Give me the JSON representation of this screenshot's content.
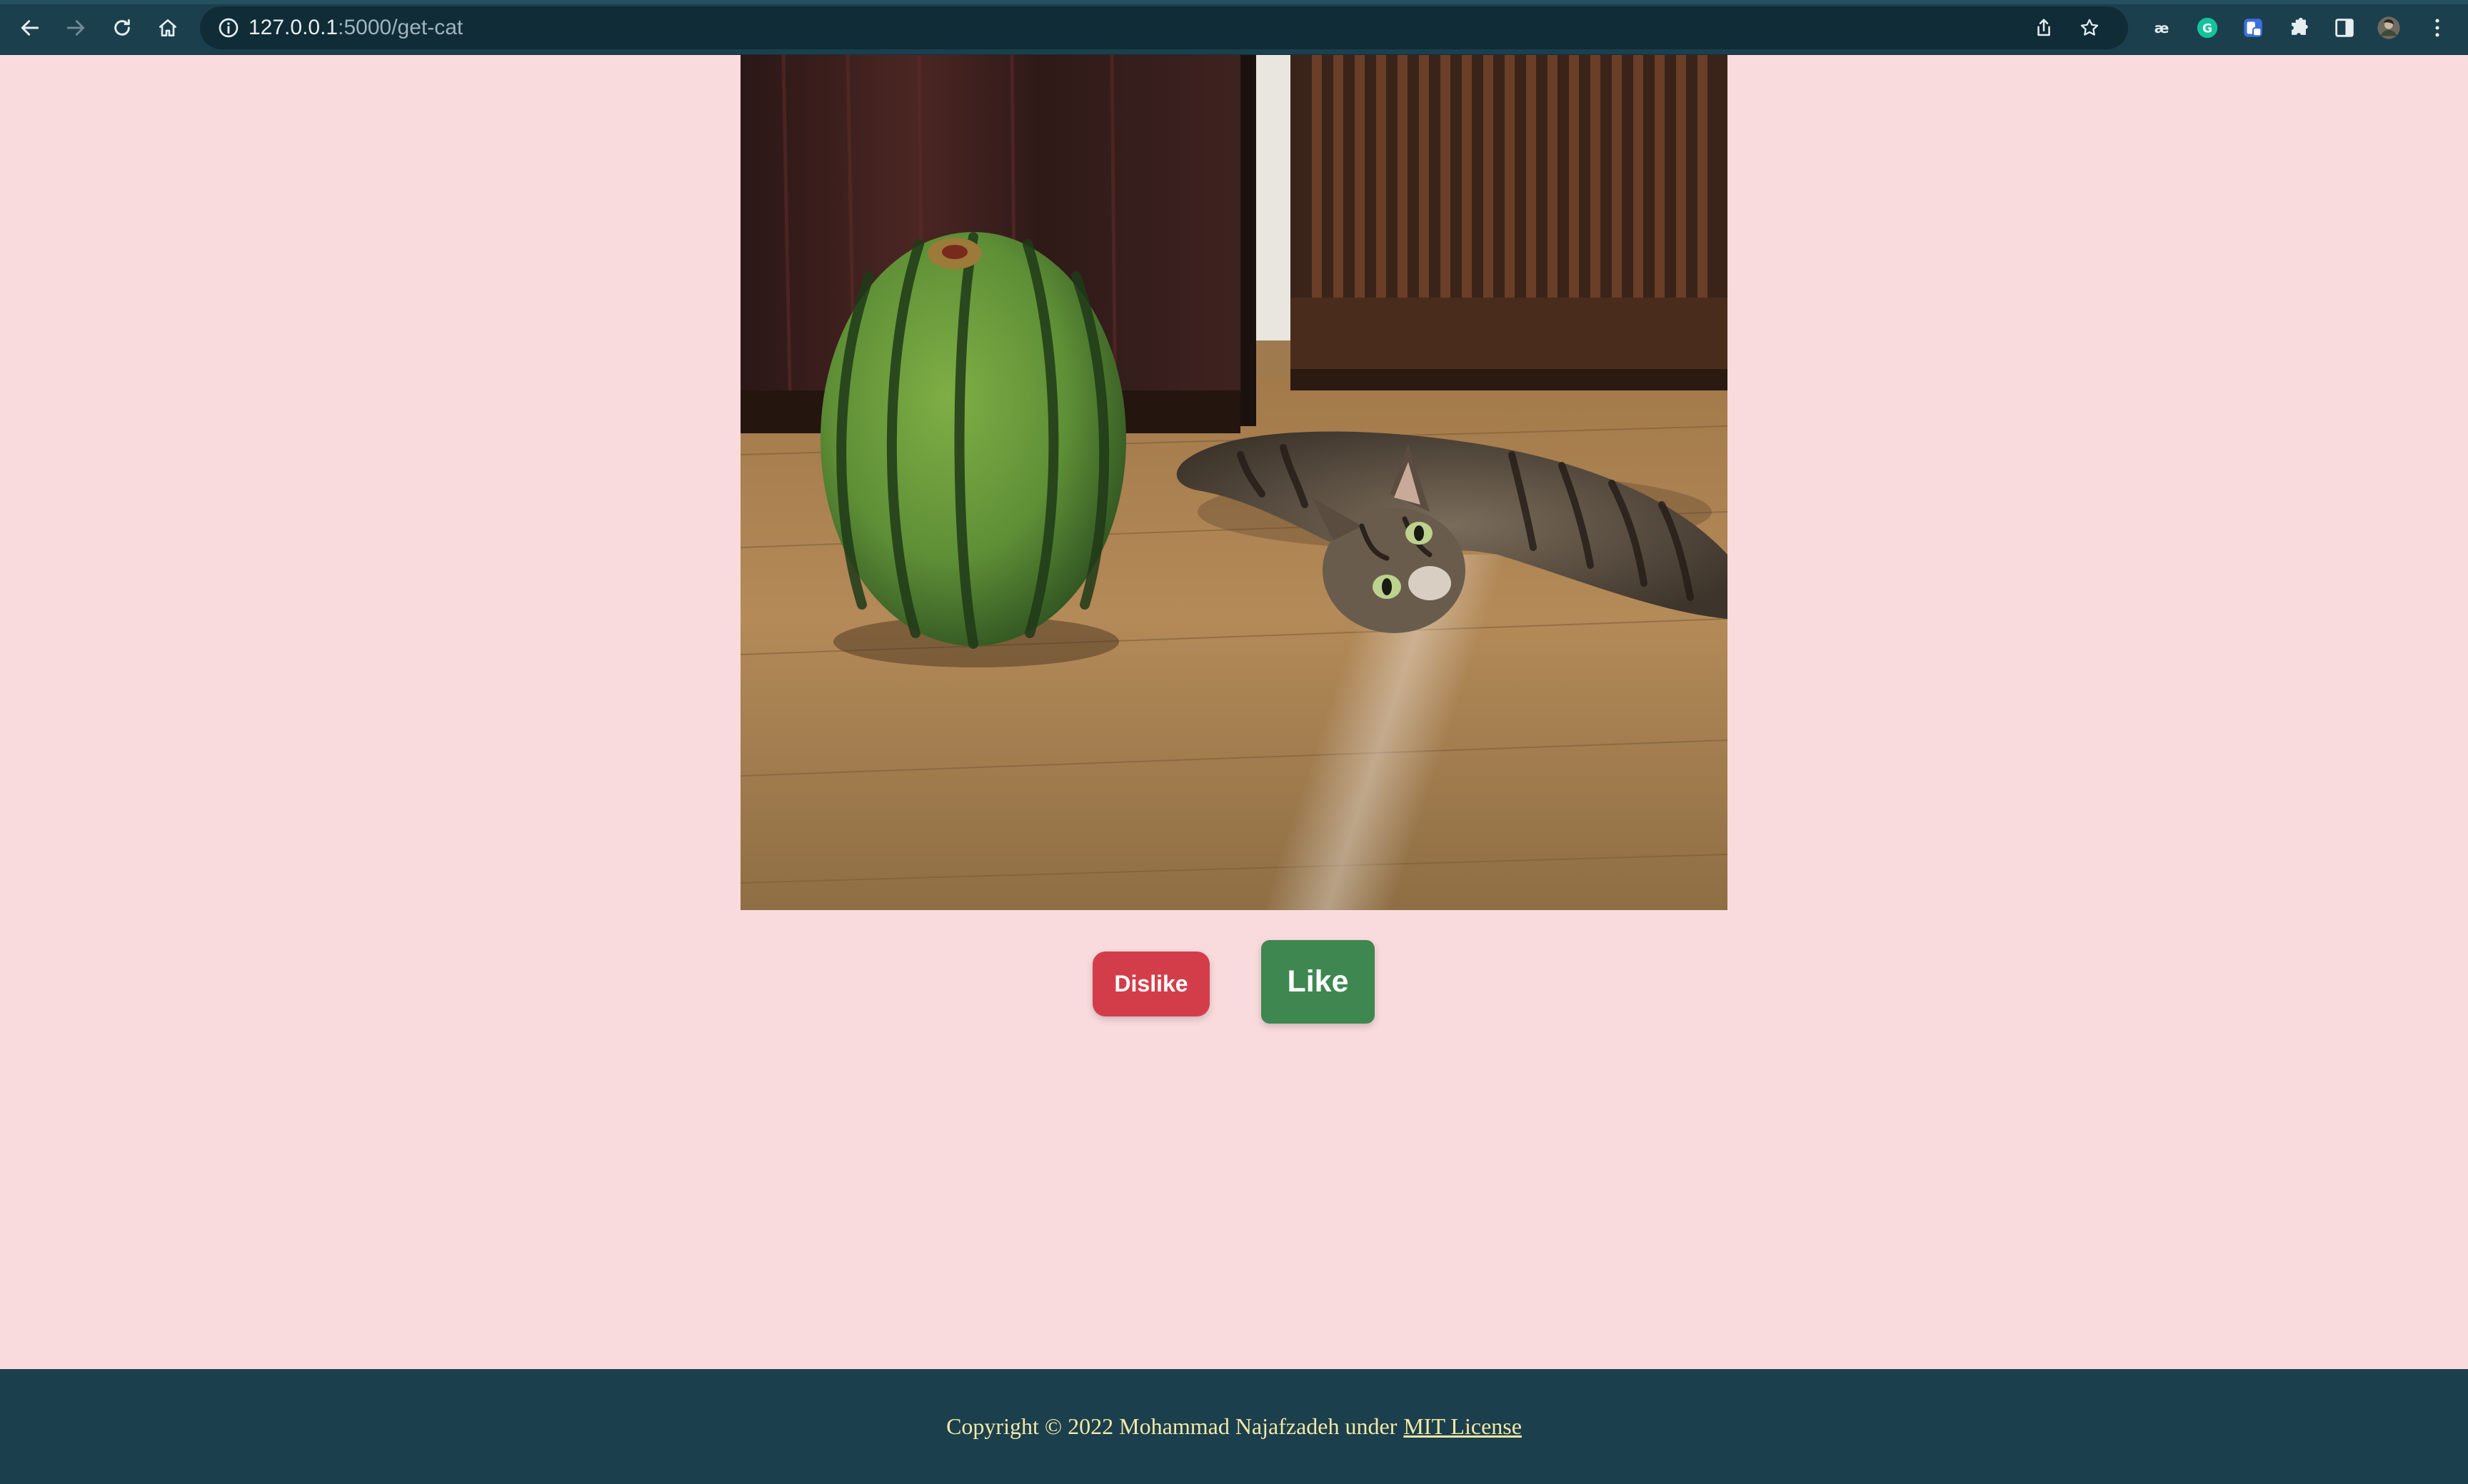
{
  "browser": {
    "url_host": "127.0.0.1",
    "url_path": ":5000/get-cat",
    "colors": {
      "frame": "#1b3f4d",
      "omnibox": "#0f2c37"
    }
  },
  "photo": {
    "description_icon": "cat-and-watermelon-photo"
  },
  "actions": {
    "dislike_label": "Dislike",
    "like_label": "Like",
    "colors": {
      "dislike": "#d33d4a",
      "like": "#3e8750"
    }
  },
  "footer": {
    "text": "Copyright © 2022 Mohammad Najafzadeh under",
    "license_link": "MIT License",
    "colors": {
      "background": "#1b3f4d",
      "text": "#f4e8a6"
    }
  },
  "page": {
    "background": "#fadbdd"
  }
}
